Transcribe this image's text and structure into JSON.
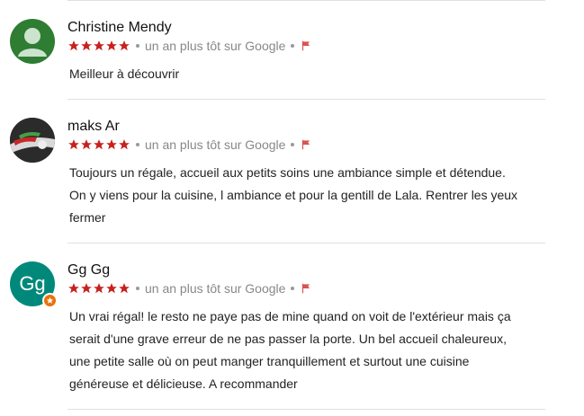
{
  "reviews": [
    {
      "name": "Christine Mendy",
      "rating": 5,
      "time": "un an plus tôt sur Google",
      "text": "Meilleur à découvrir",
      "avatar": "default-person-avatar",
      "avatar_color": "#2e7d32"
    },
    {
      "name": "maks Ar",
      "rating": 5,
      "time": "un an plus tôt sur Google",
      "text_lines": [
        "Toujours un régale, accueil aux petits soins une ambiance simple et détendue.",
        "On y viens pour la cuisine, l ambiance et pour la gentill de Lala. Rentrer les yeux",
        "fermer"
      ],
      "avatar": "photo-avatar"
    },
    {
      "name": "Gg Gg",
      "rating": 5,
      "time": "un an plus tôt sur Google",
      "text_lines": [
        "Un vrai régal! le resto ne paye pas de mine quand on voit de l'extérieur mais ça",
        "serait d'une grave erreur de ne pas passer la porte. Un bel accueil chaleureux,",
        "une petite salle où on peut manger tranquillement et surtout une cuisine",
        "généreuse et délicieuse. A recommander"
      ],
      "avatar": "initials-avatar",
      "avatar_initials": "Gg",
      "avatar_color": "#00897b",
      "badge": "local-guide-star"
    }
  ],
  "colors": {
    "star": "#c5221f",
    "flag": "#d9534f",
    "meta_text": "#888888"
  }
}
